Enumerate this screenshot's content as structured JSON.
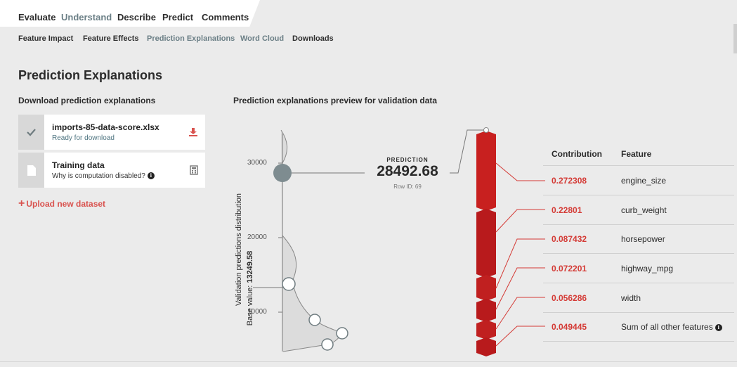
{
  "tabs": [
    {
      "label": "Evaluate",
      "active": false
    },
    {
      "label": "Understand",
      "active": true
    },
    {
      "label": "Describe",
      "active": false
    },
    {
      "label": "Predict",
      "active": false
    },
    {
      "label": "Comments",
      "active": false
    }
  ],
  "subtabs": [
    {
      "label": "Feature Impact",
      "active": false
    },
    {
      "label": "Feature Effects",
      "active": false
    },
    {
      "label": "Prediction Explanations",
      "active": true
    },
    {
      "label": "Word Cloud",
      "active": false
    },
    {
      "label": "Downloads",
      "active": false
    }
  ],
  "page_title": "Prediction Explanations",
  "download": {
    "heading": "Download prediction explanations",
    "cards": [
      {
        "title": "imports-85-data-score.xlsx",
        "subtitle": "Ready for download",
        "icon": "check-icon",
        "action_icon": "download-icon"
      },
      {
        "title": "Training data",
        "subtitle": "Why is computation disabled?",
        "icon": "document-icon",
        "action_icon": "calculator-icon"
      }
    ],
    "upload_label": "Upload new dataset"
  },
  "preview": {
    "heading": "Prediction explanations preview for validation data",
    "prediction_label": "PREDICTION",
    "prediction_value": "28492.68",
    "row_id": "Row ID: 69",
    "y_axis_label": "Validation predictions distribution",
    "base_value_label": "Base value:",
    "base_value": "13249.58",
    "y_ticks": [
      "30000",
      "20000",
      "10000"
    ]
  },
  "table": {
    "headers": {
      "contribution": "Contribution",
      "feature": "Feature"
    },
    "rows": [
      {
        "contribution": "0.272308",
        "feature": "engine_size"
      },
      {
        "contribution": "0.22801",
        "feature": "curb_weight"
      },
      {
        "contribution": "0.087432",
        "feature": "horsepower"
      },
      {
        "contribution": "0.072201",
        "feature": "highway_mpg"
      },
      {
        "contribution": "0.056286",
        "feature": "width"
      },
      {
        "contribution": "0.049445",
        "feature": "Sum of all other features"
      }
    ]
  },
  "colors": {
    "accent_red": "#c8201f",
    "active_tab": "#6b7f86",
    "contribution_red": "#d43a35"
  }
}
